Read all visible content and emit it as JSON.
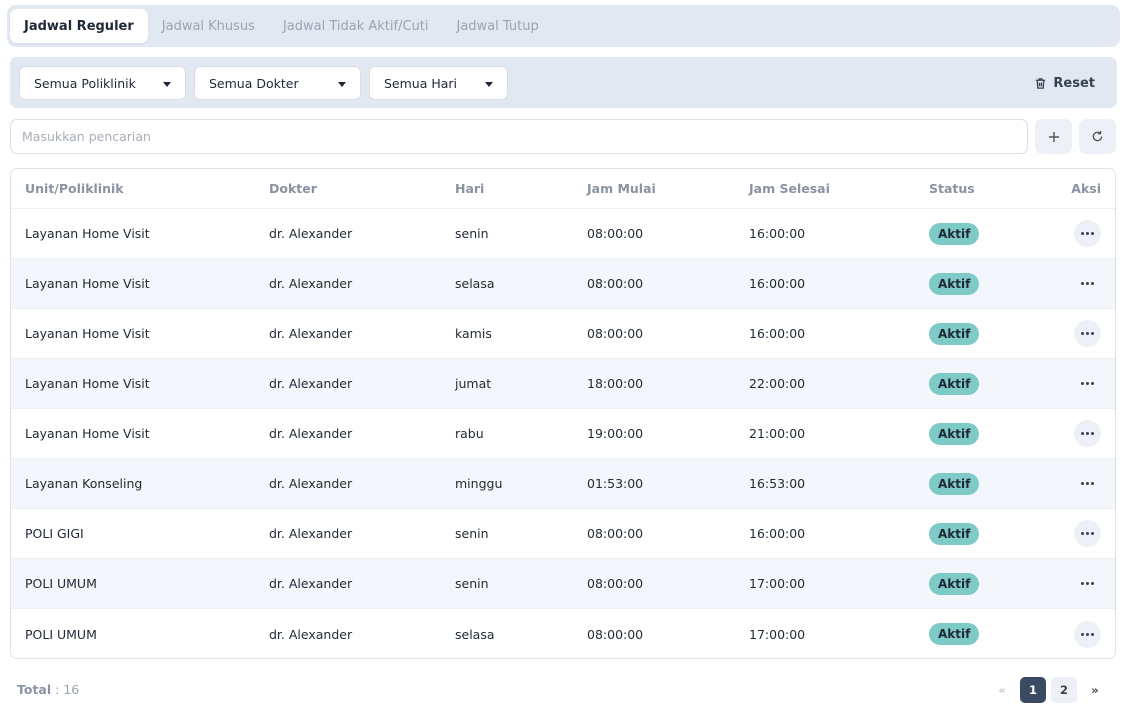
{
  "tabs": [
    {
      "label": "Jadwal Reguler",
      "active": true
    },
    {
      "label": "Jadwal Khusus",
      "active": false
    },
    {
      "label": "Jadwal Tidak Aktif/Cuti",
      "active": false
    },
    {
      "label": "Jadwal Tutup",
      "active": false
    }
  ],
  "filters": {
    "poliklinik": "Semua Poliklinik",
    "dokter": "Semua Dokter",
    "hari": "Semua Hari",
    "reset_label": "Reset"
  },
  "search": {
    "placeholder": "Masukkan pencarian",
    "value": ""
  },
  "table": {
    "headers": [
      "Unit/Poliklinik",
      "Dokter",
      "Hari",
      "Jam Mulai",
      "Jam Selesai",
      "Status",
      "Aksi"
    ],
    "rows": [
      [
        "Layanan Home Visit",
        "dr. Alexander",
        "senin",
        "08:00:00",
        "16:00:00",
        "Aktif"
      ],
      [
        "Layanan Home Visit",
        "dr. Alexander",
        "selasa",
        "08:00:00",
        "16:00:00",
        "Aktif"
      ],
      [
        "Layanan Home Visit",
        "dr. Alexander",
        "kamis",
        "08:00:00",
        "16:00:00",
        "Aktif"
      ],
      [
        "Layanan Home Visit",
        "dr. Alexander",
        "jumat",
        "18:00:00",
        "22:00:00",
        "Aktif"
      ],
      [
        "Layanan Home Visit",
        "dr. Alexander",
        "rabu",
        "19:00:00",
        "21:00:00",
        "Aktif"
      ],
      [
        "Layanan Konseling",
        "dr. Alexander",
        "minggu",
        "01:53:00",
        "16:53:00",
        "Aktif"
      ],
      [
        "POLI GIGI",
        "dr. Alexander",
        "senin",
        "08:00:00",
        "16:00:00",
        "Aktif"
      ],
      [
        "POLI UMUM",
        "dr. Alexander",
        "senin",
        "08:00:00",
        "17:00:00",
        "Aktif"
      ],
      [
        "POLI UMUM",
        "dr. Alexander",
        "selasa",
        "08:00:00",
        "17:00:00",
        "Aktif"
      ]
    ]
  },
  "footer": {
    "total_label": "Total",
    "total_value": ": 16",
    "pagination": {
      "prev": "«",
      "pages": [
        "1",
        "2"
      ],
      "current": "1",
      "next": "»"
    }
  },
  "colors": {
    "accent": "#3a4a63",
    "status_active": "#7ecac7",
    "panel_bg": "#e2e8f2"
  }
}
